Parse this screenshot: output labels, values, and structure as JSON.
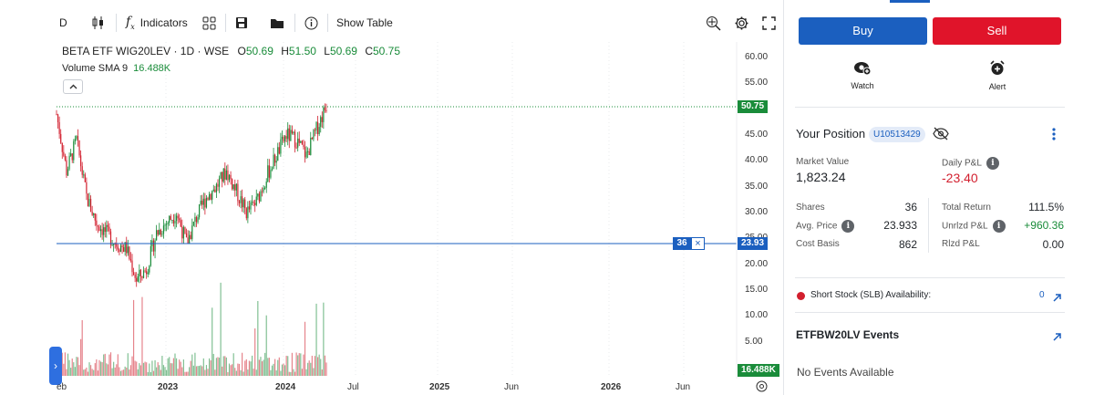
{
  "toolbar": {
    "interval_label": "D",
    "indicators_label": "Indicators",
    "show_table_label": "Show Table"
  },
  "legend": {
    "symbol_line": "BETA ETF WIG20LEV · 1D · WSE",
    "open_key": "O",
    "open_val": "50.69",
    "high_key": "H",
    "high_val": "51.50",
    "low_key": "L",
    "low_val": "50.69",
    "close_key": "C",
    "close_val": "50.75",
    "volume_label": "Volume SMA 9",
    "volume_value": "16.488K"
  },
  "price_axis": {
    "ticks": [
      "60.00",
      "55.00",
      "50.00",
      "45.00",
      "40.00",
      "35.00",
      "30.00",
      "25.00",
      "20.00",
      "15.00",
      "10.00",
      "5.00"
    ],
    "last_price_tag": "50.75",
    "avg_price_tag": "23.93",
    "position_qty_tag": "36",
    "volume_tag": "16.488K"
  },
  "time_axis": {
    "labels": [
      "eb",
      "2023",
      "2024",
      "Jul",
      "2025",
      "Jun",
      "2026",
      "Jun"
    ]
  },
  "chart_data": {
    "type": "line",
    "price_series_desc": "daily close approximation",
    "x": [
      "2022-02",
      "2022-03",
      "2022-04",
      "2022-05",
      "2022-06",
      "2022-07",
      "2022-08",
      "2022-09",
      "2022-10",
      "2022-11",
      "2022-12",
      "2023-01",
      "2023-02",
      "2023-03",
      "2023-04",
      "2023-05",
      "2023-06",
      "2023-07",
      "2023-08",
      "2023-09",
      "2023-10",
      "2023-11",
      "2023-12",
      "2024-01",
      "2024-02",
      "2024-03",
      "2024-04",
      "2024-05"
    ],
    "y": [
      49,
      38,
      44,
      33,
      28,
      26,
      24,
      23,
      17,
      19,
      26,
      28,
      30,
      24,
      29,
      33,
      35,
      38,
      34,
      30,
      32,
      37,
      41,
      45,
      44,
      41,
      46,
      50.75
    ],
    "ylim": [
      0,
      62
    ],
    "reference_lines": [
      {
        "label": "Last",
        "value": 50.75
      },
      {
        "label": "Avg. Price",
        "value": 23.93
      }
    ],
    "volume_sma": 16.488
  },
  "panel": {
    "buy_label": "Buy",
    "sell_label": "Sell",
    "watch_label": "Watch",
    "alert_label": "Alert",
    "position_title": "Your Position",
    "account_id": "U10513429",
    "market_value_label": "Market Value",
    "market_value": "1,823.24",
    "daily_pnl_label": "Daily P&L",
    "daily_pnl": "-23.40",
    "rows_left": [
      {
        "label": "Shares",
        "value": "36"
      },
      {
        "label": "Avg. Price",
        "value": "23.933"
      },
      {
        "label": "Cost Basis",
        "value": "862"
      }
    ],
    "rows_right": [
      {
        "label": "Total Return",
        "value": "111.5%"
      },
      {
        "label": "Unrlzd P&L",
        "value": "+960.36"
      },
      {
        "label": "Rlzd P&L",
        "value": "0.00"
      }
    ],
    "slb_label": "Short Stock (SLB) Availability:",
    "slb_value": "0",
    "events_title": "ETFBW20LV Events",
    "events_empty": "No Events Available"
  },
  "colors": {
    "up": "#1a8c3a",
    "down": "#d21f2e",
    "accent": "#1b5fbf",
    "sell": "#e0142a"
  }
}
